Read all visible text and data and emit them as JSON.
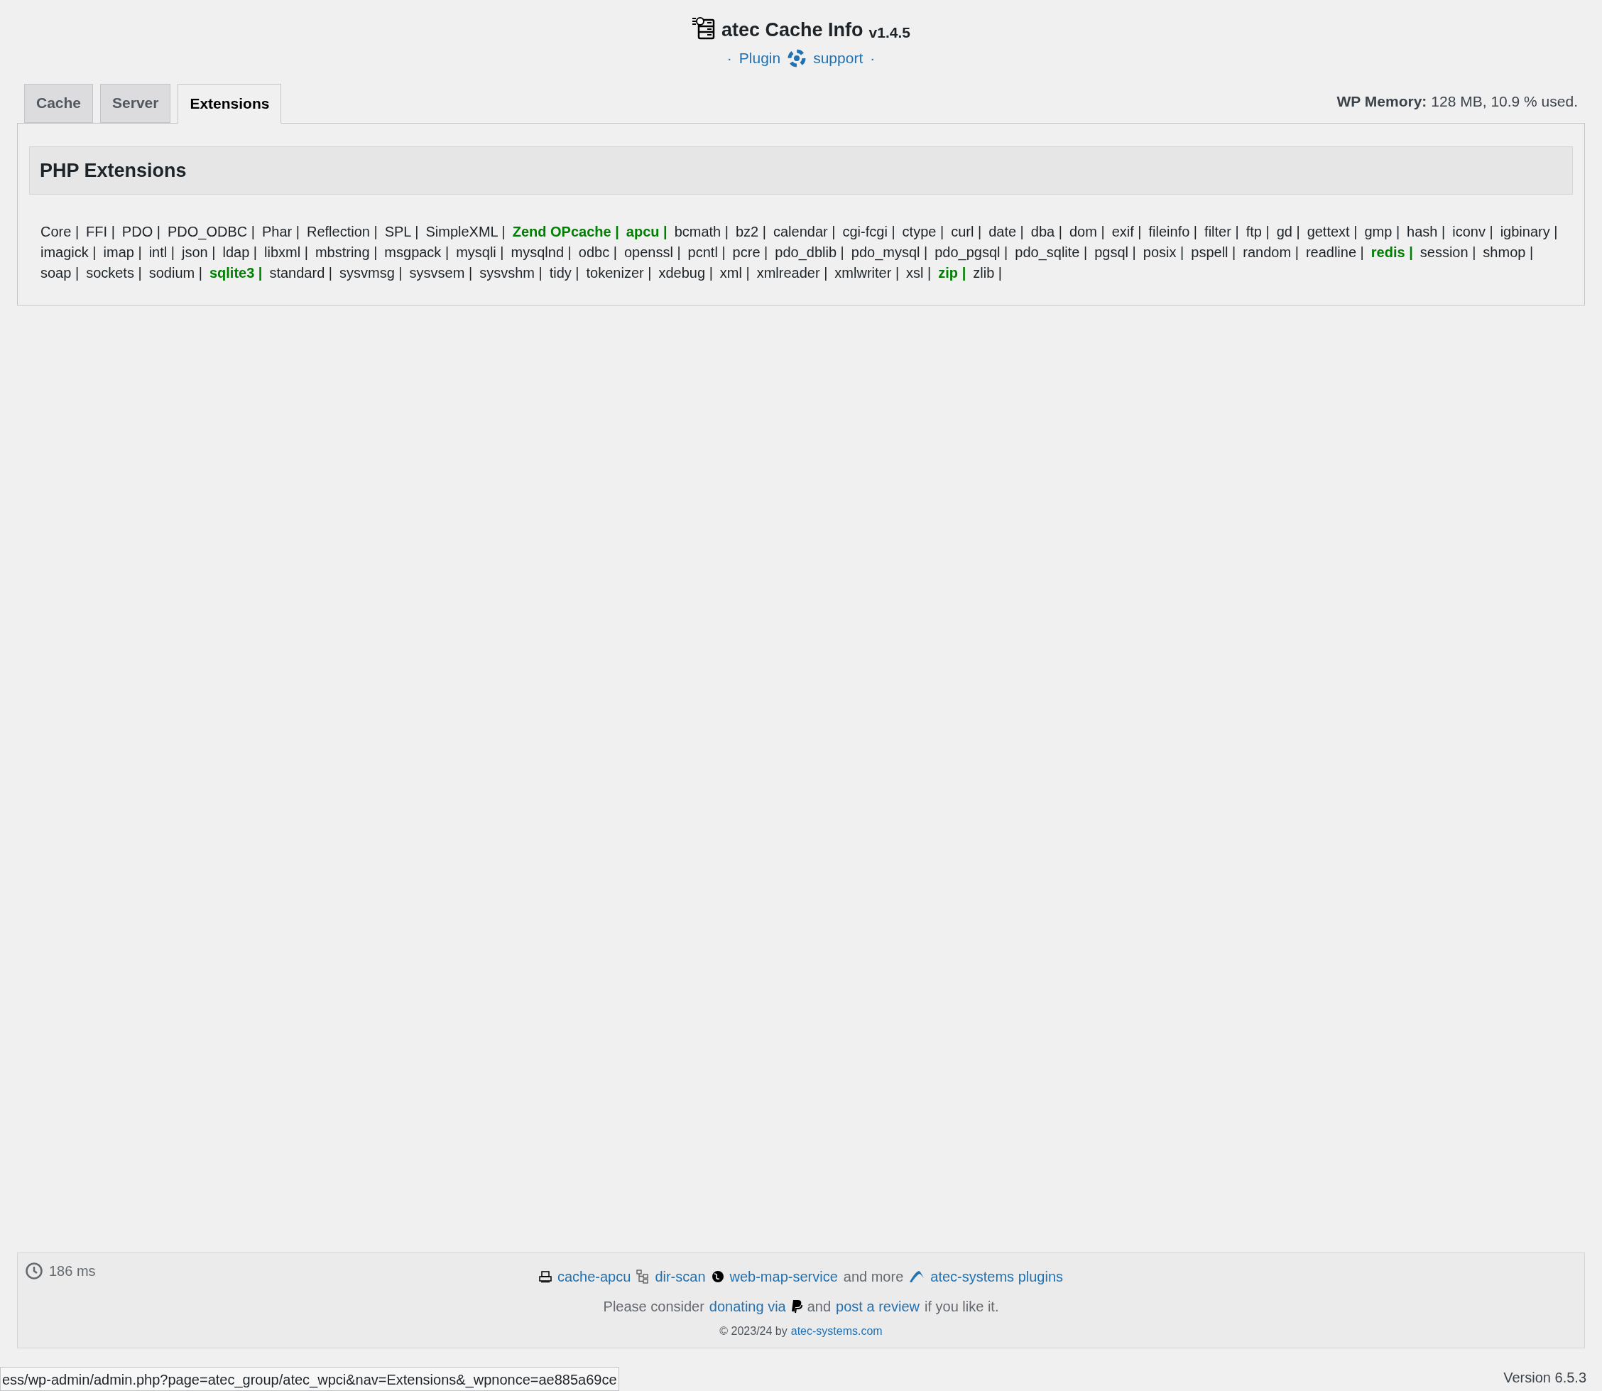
{
  "header": {
    "title": "atec Cache Info",
    "version": "v1.4.5",
    "links": [
      {
        "kind": "text",
        "text": "·"
      },
      {
        "kind": "link",
        "text": "Plugin"
      },
      {
        "kind": "icon"
      },
      {
        "kind": "link",
        "text": "support"
      },
      {
        "kind": "text",
        "text": "·"
      }
    ]
  },
  "tabs": [
    {
      "label": "Cache",
      "selected": false
    },
    {
      "label": "Server",
      "selected": false
    },
    {
      "label": "Extensions",
      "selected": true
    }
  ],
  "memory": {
    "label": "WP Memory:",
    "value": "128 MB, 10.9 % used."
  },
  "section": {
    "title": "PHP Extensions",
    "extensions": [
      {
        "text": "Core |",
        "highlighted": false
      },
      {
        "text": "FFI |",
        "highlighted": false
      },
      {
        "text": "PDO |",
        "highlighted": false
      },
      {
        "text": "PDO_ODBC |",
        "highlighted": false
      },
      {
        "text": "Phar |",
        "highlighted": false
      },
      {
        "text": "Reflection |",
        "highlighted": false
      },
      {
        "text": "SPL |",
        "highlighted": false
      },
      {
        "text": "SimpleXML |",
        "highlighted": false
      },
      {
        "text": "Zend OPcache |",
        "highlighted": true
      },
      {
        "text": "apcu |",
        "highlighted": true
      },
      {
        "text": "bcmath |",
        "highlighted": false
      },
      {
        "text": "bz2 |",
        "highlighted": false
      },
      {
        "text": "calendar |",
        "highlighted": false
      },
      {
        "text": "cgi-fcgi |",
        "highlighted": false
      },
      {
        "text": "ctype |",
        "highlighted": false
      },
      {
        "text": "curl |",
        "highlighted": false
      },
      {
        "text": "date |",
        "highlighted": false
      },
      {
        "text": "dba |",
        "highlighted": false
      },
      {
        "text": "dom |",
        "highlighted": false
      },
      {
        "text": "exif |",
        "highlighted": false
      },
      {
        "text": "fileinfo |",
        "highlighted": false
      },
      {
        "text": "filter |",
        "highlighted": false
      },
      {
        "text": "ftp |",
        "highlighted": false
      },
      {
        "text": "gd |",
        "highlighted": false
      },
      {
        "text": "gettext |",
        "highlighted": false
      },
      {
        "text": "gmp |",
        "highlighted": false
      },
      {
        "text": "hash |",
        "highlighted": false
      },
      {
        "text": "iconv |",
        "highlighted": false
      },
      {
        "text": "igbinary |",
        "highlighted": false
      },
      {
        "text": "imagick |",
        "highlighted": false
      },
      {
        "text": "imap |",
        "highlighted": false
      },
      {
        "text": "intl |",
        "highlighted": false
      },
      {
        "text": "json |",
        "highlighted": false
      },
      {
        "text": "ldap |",
        "highlighted": false
      },
      {
        "text": "libxml |",
        "highlighted": false
      },
      {
        "text": "mbstring |",
        "highlighted": false
      },
      {
        "text": "msgpack |",
        "highlighted": false
      },
      {
        "text": "mysqli |",
        "highlighted": false
      },
      {
        "text": "mysqlnd |",
        "highlighted": false
      },
      {
        "text": "odbc |",
        "highlighted": false
      },
      {
        "text": "openssl |",
        "highlighted": false
      },
      {
        "text": "pcntl |",
        "highlighted": false
      },
      {
        "text": "pcre |",
        "highlighted": false
      },
      {
        "text": "pdo_dblib |",
        "highlighted": false
      },
      {
        "text": "pdo_mysql |",
        "highlighted": false
      },
      {
        "text": "pdo_pgsql |",
        "highlighted": false
      },
      {
        "text": "pdo_sqlite |",
        "highlighted": false
      },
      {
        "text": "pgsql |",
        "highlighted": false
      },
      {
        "text": "posix |",
        "highlighted": false
      },
      {
        "text": "pspell |",
        "highlighted": false
      },
      {
        "text": "random |",
        "highlighted": false
      },
      {
        "text": "readline |",
        "highlighted": false
      },
      {
        "text": "redis |",
        "highlighted": true
      },
      {
        "text": "session |",
        "highlighted": false
      },
      {
        "text": "shmop |",
        "highlighted": false
      },
      {
        "text": "soap |",
        "highlighted": false
      },
      {
        "text": "sockets |",
        "highlighted": false
      },
      {
        "text": "sodium |",
        "highlighted": false
      },
      {
        "text": "sqlite3 |",
        "highlighted": true
      },
      {
        "text": "standard |",
        "highlighted": false
      },
      {
        "text": "sysvmsg |",
        "highlighted": false
      },
      {
        "text": "sysvsem |",
        "highlighted": false
      },
      {
        "text": "sysvshm |",
        "highlighted": false
      },
      {
        "text": "tidy |",
        "highlighted": false
      },
      {
        "text": "tokenizer |",
        "highlighted": false
      },
      {
        "text": "xdebug |",
        "highlighted": false
      },
      {
        "text": "xml |",
        "highlighted": false
      },
      {
        "text": "xmlreader |",
        "highlighted": false
      },
      {
        "text": "xmlwriter |",
        "highlighted": false
      },
      {
        "text": "xsl |",
        "highlighted": false
      },
      {
        "text": "zip |",
        "highlighted": true
      },
      {
        "text": "zlib |",
        "highlighted": false
      }
    ]
  },
  "footer": {
    "timing": "186 ms",
    "plugins": [
      {
        "kind": "printer",
        "text": "cache-apcu",
        "link": true
      },
      {
        "kind": "tree",
        "text": "dir-scan",
        "link": true
      },
      {
        "kind": "globe",
        "text": "web-map-service",
        "link": true
      },
      {
        "kind": "none",
        "text": "and more",
        "link": false
      },
      {
        "kind": "logo",
        "text": "atec-systems plugins",
        "link": true
      }
    ],
    "donate": [
      {
        "text": "Please consider",
        "link": false
      },
      {
        "text": "donating via",
        "link": true,
        "icon": true
      },
      {
        "text": "and",
        "link": false
      },
      {
        "text": "post a review",
        "link": true
      },
      {
        "text": "if you like it.",
        "link": false
      }
    ],
    "copyright": "© 2023/24 by",
    "copyright_link": "atec-systems.com"
  },
  "version": "Version 6.5.3",
  "status_url": "ess/wp-admin/admin.php?page=atec_group/atec_wpci&nav=Extensions&_wpnonce=ae885a69ce"
}
